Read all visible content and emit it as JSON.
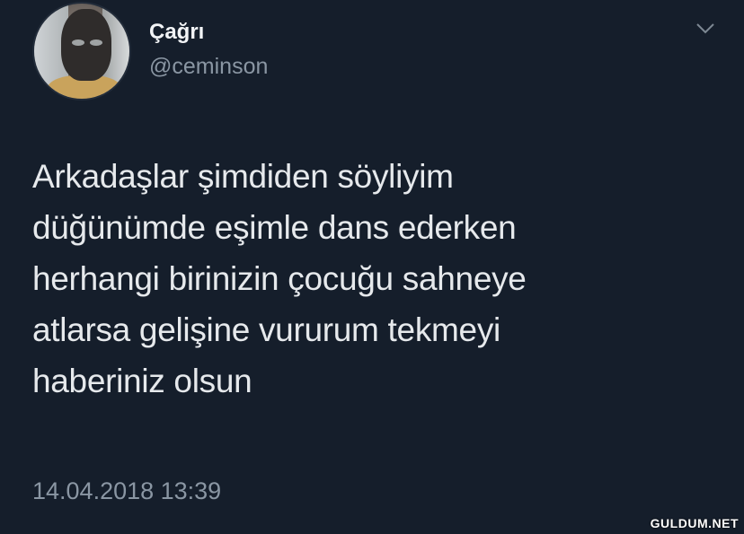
{
  "user": {
    "name": "Çağrı",
    "handle": "@ceminson"
  },
  "tweet": {
    "lines": [
      "Arkadaşlar şimdiden söyliyim",
      "düğünümde eşimle dans ederken",
      "herhangi birinizin çocuğu sahneye",
      "atlarsa gelişine vururum tekmeyi",
      "haberiniz olsun"
    ],
    "timestamp": "14.04.2018 13:39"
  },
  "watermark": "GULDUM.NET",
  "icons": {
    "menu": "chevron-down-icon",
    "avatar": "profile-photo"
  },
  "colors": {
    "background": "#151e2b",
    "text": "#e6e9ec",
    "secondary_text": "#8a96a3"
  }
}
